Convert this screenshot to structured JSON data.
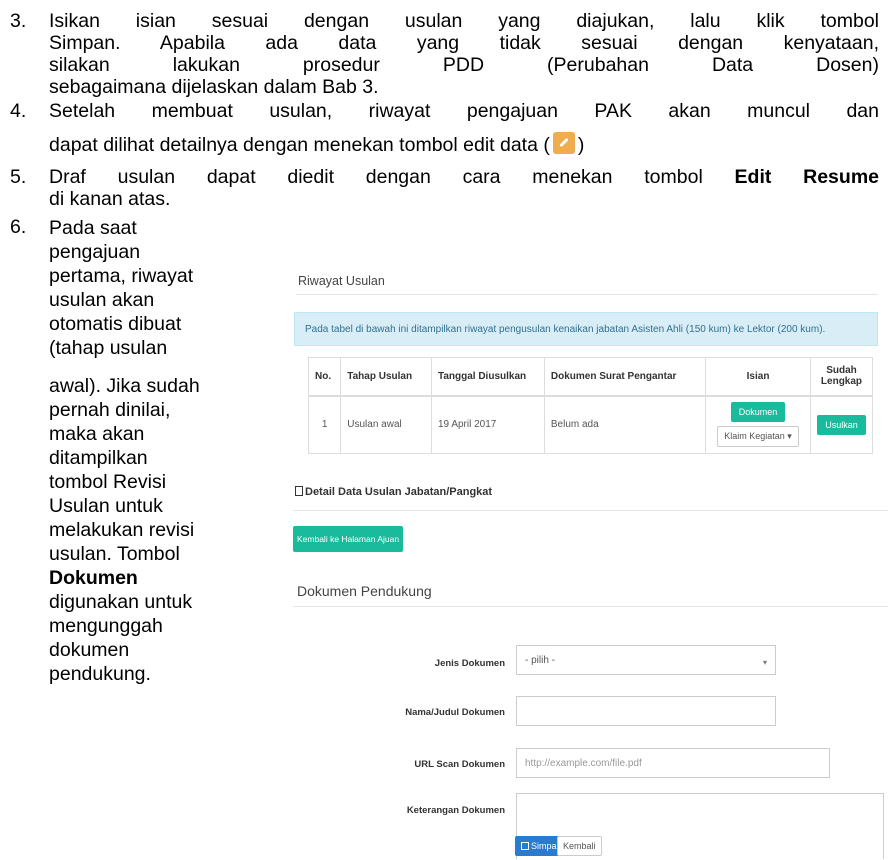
{
  "items": [
    {
      "num": "3.",
      "lines": [
        "Isikan isian sesuai dengan usulan yang diajukan, lalu klik tombol",
        "Simpan. Apabila ada data yang tidak sesuai dengan kenyataan,",
        "silakan lakukan prosedur PDD (Perubahan Data Dosen)",
        "sebagaimana dijelaskan dalam Bab 3."
      ]
    },
    {
      "num": "4.",
      "line1": "Setelah membuat usulan, riwayat pengajuan PAK akan muncul dan",
      "line2_before": "dapat dilihat detailnya dengan menekan tombol edit data (",
      "line2_after": ")"
    },
    {
      "num": "5.",
      "line1_before": "Draf usulan dapat diedit dengan cara menekan tombol",
      "line1_bold": "Edit Resume",
      "line2": "di kanan atas."
    },
    {
      "num": "6.",
      "lines_a": [
        "Pada saat",
        "pengajuan",
        "pertama, riwayat",
        "usulan akan",
        "otomatis dibuat",
        "(tahap usulan"
      ],
      "lines_b": [
        "awal). Jika sudah",
        "pernah dinilai,",
        "maka akan",
        "ditampilkan",
        "tombol Revisi",
        "Usulan untuk",
        "melakukan revisi",
        "usulan. Tombol"
      ],
      "bold": "Dokumen",
      "lines_c": [
        "digunakan untuk",
        "mengunggah",
        "dokumen",
        "pendukung."
      ]
    }
  ],
  "riwayat": {
    "title": "Riwayat Usulan",
    "alert": "Pada tabel di bawah ini ditampilkan riwayat pengusulan kenaikan jabatan Asisten Ahli (150 kum) ke Lektor (200 kum).",
    "headers": [
      "No.",
      "Tahap Usulan",
      "Tanggal Diusulkan",
      "Dokumen Surat Pengantar",
      "Isian",
      "Sudah Lengkap"
    ],
    "row": {
      "no": "1",
      "tahap": "Usulan awal",
      "tanggal": "19 April 2017",
      "dokumen": "Belum ada",
      "btn_dokumen": "Dokumen",
      "btn_klaim": "Klaim Kegiatan ▾",
      "btn_usulkan": "Usulkan"
    }
  },
  "detail": {
    "title": "Detail Data Usulan Jabatan/Pangkat",
    "back_button": "Kembali ke Halaman Ajuan",
    "section": "Dokumen Pendukung",
    "fields": {
      "jenis_label": "Jenis Dokumen",
      "jenis_value": "- pilih -",
      "nama_label": "Nama/Judul Dokumen",
      "url_label": "URL Scan Dokumen",
      "url_placeholder": "http://example.com/file.pdf",
      "ket_label": "Keterangan Dokumen"
    },
    "save_button": "Simpan",
    "cancel_button": "Kembali"
  },
  "colors": {
    "primary_green": "#1abb9c",
    "primary_blue": "#2a7ad0",
    "alert_bg": "#d9edf7",
    "danger": "#d9534f",
    "edit_orange": "#f0ad4e"
  }
}
